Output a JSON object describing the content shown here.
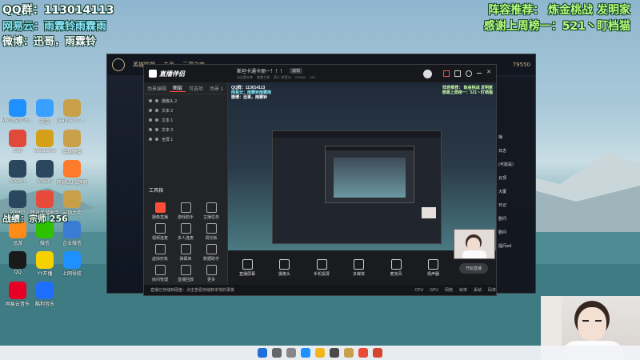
{
  "overlay": {
    "qq_group": "QQ群：113014113",
    "netease": "网易云：雨霖铃雨霖雨",
    "weibo": "微博：迅哥，雨霖铃",
    "recommend": "阵容推荐： 炼金桃战 发明家",
    "thanks": "感谢上周榜一：521丶盯档猫",
    "rank": "战绩：宗师 256"
  },
  "desktop_icons": [
    "Microsoft Edge",
    "迅雷",
    "League of Legends",
    "360",
    "WeGame",
    "英雄联盟",
    "Steam",
    "Steam",
    "网易UU加速器",
    "Steam",
    "腾讯手游助手",
    "云顶之弈",
    "迅游",
    "微信",
    "企业微信",
    "QQ",
    "YY开播",
    "上网导航",
    "网易云音乐",
    "酷狗音乐"
  ],
  "lol_window": {
    "nav": [
      "英雄联盟",
      "主页",
      "云顶之弈",
      "商城"
    ],
    "currency": "79550"
  },
  "stream_app": {
    "logo": "直播伴侣",
    "left_tabs": [
      "场景编辑",
      "图层",
      "可选项",
      "场景 1"
    ],
    "active_tab": "图层",
    "layers": [
      "摄像头 2",
      "文本 2",
      "文本 1",
      "文本 3",
      "全屏 1"
    ],
    "tools_title": "工具箱",
    "tools": [
      "摄像直播",
      "游戏助手",
      "主播任务",
      "视频连麦",
      "多人连麦",
      "调光板",
      "虚拟形象",
      "弹幕库",
      "数据助手",
      "房间管理",
      "直播回放",
      "更多"
    ],
    "title": "斯坦卡通卡丽一！！！",
    "title_tag": "编辑",
    "subtitle_items": [
      "以运营文库",
      "查看工具",
      "双人-茶音36",
      "210530",
      "129"
    ],
    "bottom_buttons": [
      "直播屏幕",
      "摄像头",
      "手机投屏",
      "多媒体",
      "麦克风",
      "扬声器"
    ],
    "start_live": "开始直播",
    "status": [
      "直播已存储到硬盘：点击查看存储到本地的录像",
      "CPU",
      "GPU",
      "网络",
      "帧率",
      "丢帧",
      "码率"
    ]
  },
  "chat": {
    "lines": [
      "梅",
      "日志",
      "(可能是)",
      "云顶",
      "大厦",
      "日记",
      "剧问",
      "剧问",
      "提问ad"
    ]
  },
  "taskbar": {
    "icons": [
      "windows-start",
      "search",
      "task-view",
      "edge",
      "explorer",
      "store",
      "lol",
      "stream-app",
      "game"
    ]
  }
}
